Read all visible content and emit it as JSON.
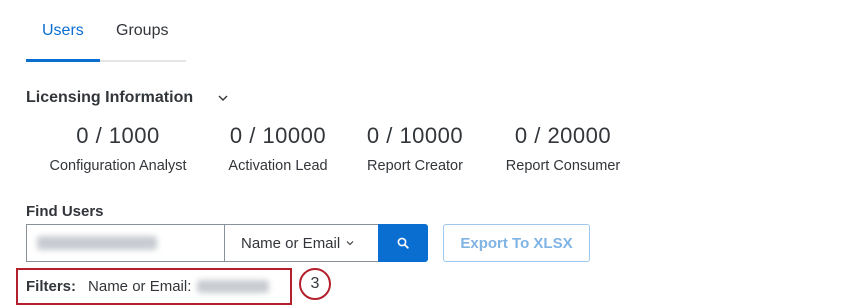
{
  "tabs": [
    {
      "label": "Users",
      "active": true
    },
    {
      "label": "Groups",
      "active": false
    }
  ],
  "licensing": {
    "title": "Licensing Information",
    "stats": [
      {
        "value": "0 / 1000",
        "label": "Configuration Analyst"
      },
      {
        "value": "0 / 10000",
        "label": "Activation Lead"
      },
      {
        "value": "0 / 10000",
        "label": "Report Creator"
      },
      {
        "value": "0 / 20000",
        "label": "Report Consumer"
      }
    ]
  },
  "find_users": {
    "label": "Find Users",
    "select_value": "Name or Email",
    "export_label": "Export To XLSX"
  },
  "filters": {
    "label": "Filters:",
    "field": "Name or Email:"
  },
  "callout": "3",
  "colors": {
    "accent": "#0a6ed1",
    "highlight": "#b3202c"
  }
}
